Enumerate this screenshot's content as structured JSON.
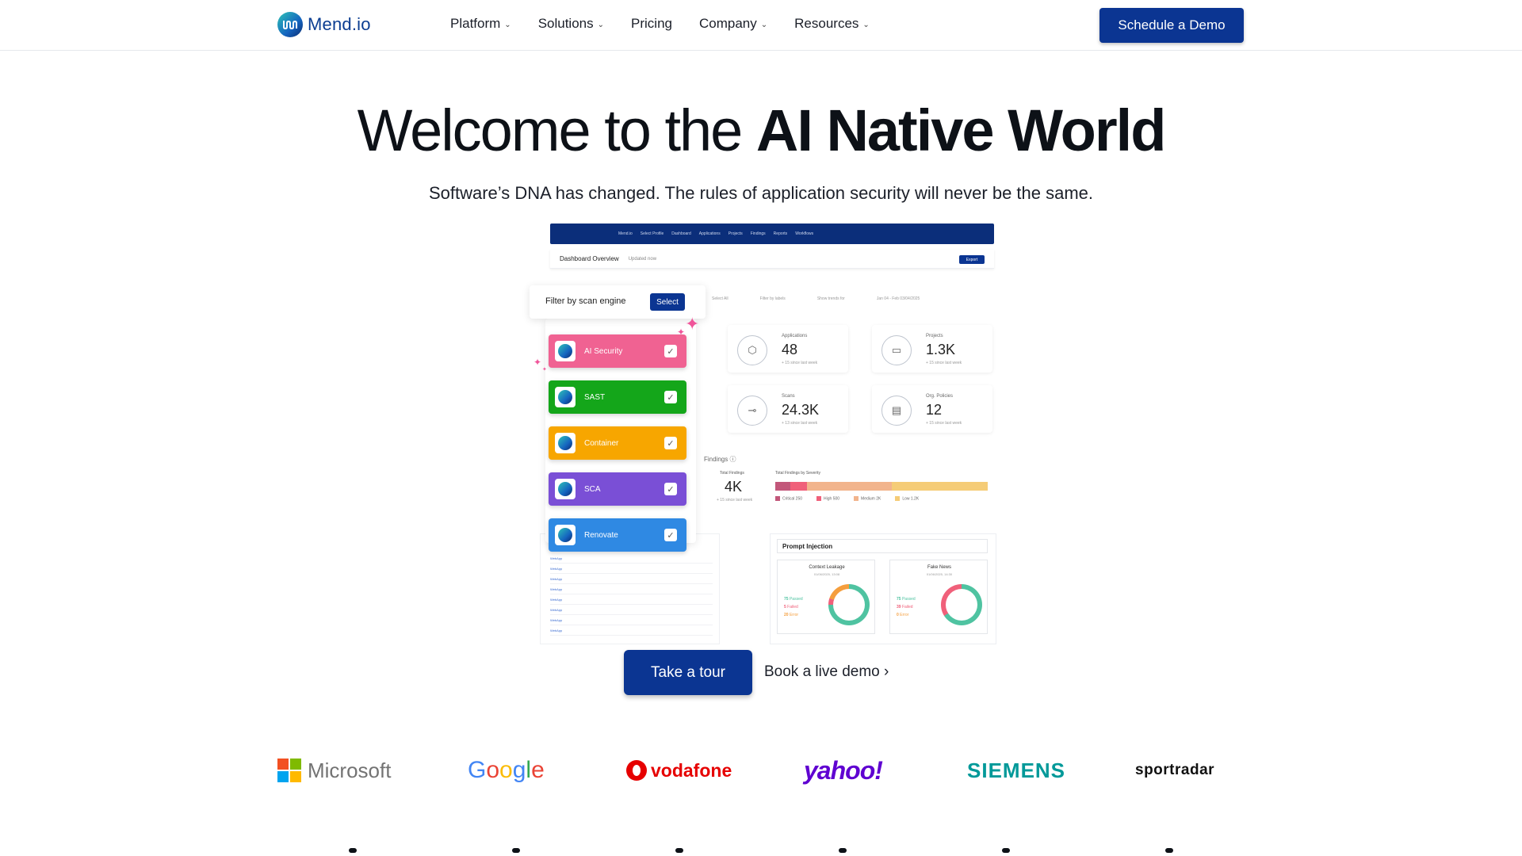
{
  "header": {
    "logo_text": "Mend.io",
    "nav": [
      {
        "label": "Platform",
        "has_menu": true
      },
      {
        "label": "Solutions",
        "has_menu": true
      },
      {
        "label": "Pricing",
        "has_menu": false
      },
      {
        "label": "Company",
        "has_menu": true
      },
      {
        "label": "Resources",
        "has_menu": true
      }
    ],
    "chevron": "⌄",
    "cta": "Schedule a Demo"
  },
  "hero": {
    "title_light": "Welcome to the ",
    "title_bold": "AI Native World",
    "subtitle": "Software’s DNA has changed. The rules of application security will never be the same."
  },
  "mockup": {
    "topbar_items": [
      "Mend.io",
      "Select Profile",
      "Dashboard",
      "Applications",
      "Projects",
      "Findings",
      "Reports",
      "Workflows"
    ],
    "bar_title": "Dashboard Overview",
    "bar_updated": "Updated now",
    "bar_export": "Export",
    "filters": [
      "Select All",
      "Filter by labels",
      "Show trends for",
      "Jan 04 - Feb 03/04/2025"
    ],
    "stats": [
      {
        "label": "Applications",
        "value": "48",
        "note": "+ 15 since last week",
        "icon": "cube-icon",
        "glyph": "⬡"
      },
      {
        "label": "Projects",
        "value": "1.3K",
        "note": "+ 15 since last week",
        "icon": "folder-icon",
        "glyph": "▭"
      },
      {
        "label": "Scans",
        "value": "24.3K",
        "note": "+ 13 since last week",
        "icon": "scan-icon",
        "glyph": "⊸"
      },
      {
        "label": "Org. Policies",
        "value": "12",
        "note": "+ 15 since last week",
        "icon": "clipboard-icon",
        "glyph": "▤"
      }
    ],
    "findings": {
      "title": "Findings ⓘ",
      "total_label": "Total Findings",
      "total_value": "4K",
      "total_note": "+ 15 since last week",
      "severity_label": "Total Findings by Severity",
      "severity": [
        {
          "name": "Critical",
          "count": "250",
          "share": 0.07,
          "color": "#c2577a"
        },
        {
          "name": "High",
          "count": "500",
          "share": 0.08,
          "color": "#f0607a"
        },
        {
          "name": "Medium",
          "count": "2K",
          "share": 0.4,
          "color": "#f2b48c"
        },
        {
          "name": "Low",
          "count": "1.2K",
          "share": 0.45,
          "color": "#f5cc77"
        }
      ]
    },
    "table": {
      "header": "Application",
      "rows": [
        "WebApp",
        "WebApp",
        "WebApp",
        "WebApp",
        "WebApp",
        "WebApp",
        "WebApp",
        "WebApp"
      ]
    },
    "prompt": {
      "title": "Prompt Injection",
      "cards": [
        {
          "title": "Context Leakage",
          "date": "01/06/2025, 13:08",
          "passed": "75",
          "failed": "5",
          "error": "20",
          "passed_share": 0.75,
          "failed_share": 0.05,
          "error_share": 0.2
        },
        {
          "title": "Fake News",
          "date": "01/06/2025, 14:30",
          "passed": "75",
          "failed": "39",
          "error": "0",
          "passed_share": 0.66,
          "failed_share": 0.34,
          "error_share": 0.0
        }
      ],
      "labels": {
        "passed": "Passed",
        "failed": "Failed",
        "error": "Error"
      },
      "colors": {
        "passed": "#4fc3a1",
        "failed": "#f0607a",
        "error": "#f59e3d"
      }
    },
    "filter_pill": {
      "label": "Filter by scan engine",
      "button": "Select"
    },
    "engines": [
      {
        "label": "AI Security",
        "color": "#f06292"
      },
      {
        "label": "SAST",
        "color": "#14a61a"
      },
      {
        "label": "Container",
        "color": "#f7a600"
      },
      {
        "label": "SCA",
        "color": "#7a4fd6"
      },
      {
        "label": "Renovate",
        "color": "#2f89e3"
      }
    ],
    "check_glyph": "✓"
  },
  "cta": {
    "primary": "Take a tour",
    "secondary": "Book a live demo ›"
  },
  "logos": {
    "microsoft": "Microsoft",
    "google": "Google",
    "vodafone": "vodafone",
    "yahoo": "yahoo!",
    "siemens": "SIEMENS",
    "sportradar": "sportradar",
    "ms_colors": [
      "#f25022",
      "#7fba00",
      "#00a4ef",
      "#ffb900"
    ],
    "google_colors": [
      "#4285f4",
      "#ea4335",
      "#fbbc05",
      "#4285f4",
      "#34a853",
      "#ea4335"
    ]
  }
}
